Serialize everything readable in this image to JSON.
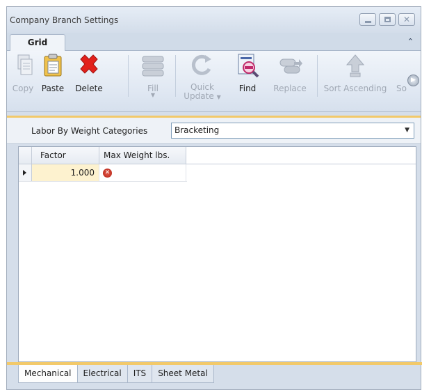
{
  "window": {
    "title": "Company Branch Settings",
    "buttons": [
      "minimize",
      "maximize",
      "close"
    ]
  },
  "ribbon": {
    "tab": "Grid",
    "buttons": [
      {
        "label": "Copy",
        "icon": "copy-icon",
        "enabled": false
      },
      {
        "label": "Paste",
        "icon": "paste-icon",
        "enabled": true
      },
      {
        "label": "Delete",
        "icon": "delete-icon",
        "enabled": true
      },
      {
        "label": "Fill",
        "icon": "fill-icon",
        "enabled": false,
        "dropdown": true
      },
      {
        "label": "Quick Update",
        "label_line1": "Quick",
        "label_line2": "Update",
        "icon": "quick-update-icon",
        "enabled": false,
        "dropdown": true
      },
      {
        "label": "Find",
        "icon": "find-icon",
        "enabled": true
      },
      {
        "label": "Replace",
        "icon": "replace-icon",
        "enabled": false
      },
      {
        "label": "Sort Ascending",
        "icon": "sort-ascending-icon",
        "enabled": false
      },
      {
        "label": "So",
        "icon": "sort-truncated",
        "enabled": false
      }
    ]
  },
  "filter": {
    "label": "Labor By Weight Categories",
    "selected": "Bracketing"
  },
  "grid": {
    "columns": [
      "Factor",
      "Max Weight lbs."
    ],
    "rows": [
      {
        "factor": "1.000",
        "max_weight_error": true
      }
    ]
  },
  "bottom_tabs": [
    "Mechanical",
    "Electrical",
    "ITS",
    "Sheet Metal"
  ],
  "active_bottom_tab": "Mechanical",
  "colors": {
    "accent": "#f2c96a",
    "chrome": "#d5deea",
    "error": "#c4281a",
    "highlight_cell": "#fdf2cf"
  }
}
